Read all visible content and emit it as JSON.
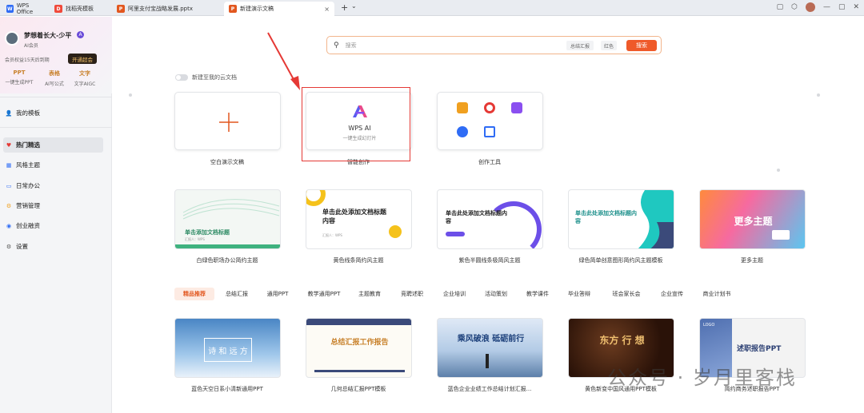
{
  "tabs": [
    {
      "label": "WPS Office",
      "icon": "wps-logo-icon",
      "color": "#2f6cf5"
    },
    {
      "label": "找稻壳模板",
      "icon": "docer-icon",
      "color": "#f04a3b"
    },
    {
      "label": "阿里支付宝战略发展.pptx",
      "icon": "ppt-file-icon",
      "color": "#e2571f"
    },
    {
      "label": "新建演示文稿",
      "icon": "ppt-file-icon",
      "color": "#e2571f"
    }
  ],
  "tab_close": "×",
  "tab_add": "+",
  "tab_dropdown": "⌄",
  "profile": {
    "name": "梦想着长大-少平",
    "badge": "A",
    "subtitle": "AI会员",
    "expiry": "会员权益15天后到期",
    "upgrade_label": "开通超会",
    "features": [
      {
        "title": "PPT",
        "desc": "一键生成PPT"
      },
      {
        "title": "表格",
        "desc": "AI写公式"
      },
      {
        "title": "文字",
        "desc": "文字AIGC"
      }
    ]
  },
  "nav": [
    {
      "label": "我的模板",
      "icon": "user-icon",
      "glyph": "👤",
      "active": false
    },
    {
      "label": "热门精选",
      "icon": "heart-icon",
      "glyph": "♥",
      "active": true
    },
    {
      "label": "风格主题",
      "icon": "palette-icon",
      "glyph": "▦",
      "active": false
    },
    {
      "label": "日常办公",
      "icon": "monitor-icon",
      "glyph": "▭",
      "active": false
    },
    {
      "label": "营销管理",
      "icon": "gear-badge-icon",
      "glyph": "⚙",
      "active": false
    },
    {
      "label": "创业融资",
      "icon": "coin-icon",
      "glyph": "◉",
      "active": false
    },
    {
      "label": "设置",
      "icon": "settings-icon",
      "glyph": "⚙",
      "active": false
    }
  ],
  "search": {
    "placeholder": "搜索",
    "chips": [
      "总结汇报",
      "红色"
    ],
    "button": "搜索"
  },
  "cloud_toggle": "新建至我的云文档",
  "create_cards": [
    {
      "label": "空白演示文稿",
      "icon": "plus-icon"
    },
    {
      "label": "智能创作",
      "title": "WPS AI",
      "subtitle": "一键生成幻灯片",
      "icon": "wps-ai-logo-icon"
    },
    {
      "label": "创作工具"
    }
  ],
  "theme_templates": [
    {
      "label": "白绿色职场办公简约主题",
      "title": "单击添加文档标题",
      "sub": "汇报人：WPS"
    },
    {
      "label": "黄色线条简约风主题",
      "title": "单击此处添加文档标题内容",
      "sub": "汇报人：WPS"
    },
    {
      "label": "紫色半圆线条极简风主题",
      "title": "单击此处添加文档标题内容",
      "sub": "汇报人：WPS"
    },
    {
      "label": "绿色简单创意图形简约风主题模板",
      "title": "单击此处添加文档标题内容",
      "sub": ""
    },
    {
      "label": "更多主题",
      "title": "更多主题",
      "sub": ""
    }
  ],
  "categories": [
    "精品推荐",
    "总结汇报",
    "通用PPT",
    "教学通用PPT",
    "主题教育",
    "竞聘述职",
    "企业培训",
    "活动策划",
    "教学课件",
    "毕业答辩",
    "班会家长会",
    "企业宣传",
    "商业计划书"
  ],
  "recommended": [
    {
      "label": "蓝色天空日系小清新通用PPT",
      "title": "诗 和 远 方"
    },
    {
      "label": "几何总结汇报PPT模板",
      "title": "总结汇报工作报告"
    },
    {
      "label": "蓝色企业业绩工作总结计划汇报...",
      "title": "乘风破浪 砥砺前行"
    },
    {
      "label": "黄色新变中国风通用PPT模板",
      "title": "东方 行 想"
    },
    {
      "label": "简约商务述职报告PPT",
      "title": "述职报告PPT",
      "logo": "LOGO"
    }
  ],
  "watermark": "公众号 · 岁月里客栈"
}
